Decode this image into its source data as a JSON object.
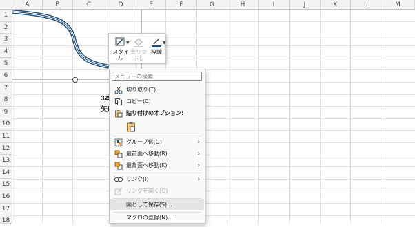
{
  "sheet": {
    "columns": [
      "A",
      "B",
      "C",
      "D",
      "E",
      "F",
      "G",
      "H",
      "I",
      "J",
      "K",
      "L",
      "M"
    ],
    "rows": [
      "1",
      "2",
      "3",
      "4",
      "5",
      "6",
      "7",
      "8",
      "9",
      "10",
      "11",
      "12",
      "13",
      "14",
      "15",
      "16",
      "17",
      "18",
      "19",
      "20"
    ],
    "cell_text_1": "3本",
    "cell_text_2": "矢印"
  },
  "mini_toolbar": {
    "style_label": "スタイル",
    "fill_label": "塗りつぶし",
    "outline_label": "枠線"
  },
  "context_menu": {
    "search_placeholder": "メニューの検索",
    "items": [
      {
        "label": "切り取り(T)",
        "icon": "scissors-icon"
      },
      {
        "label": "コピー(C)",
        "icon": "copy-icon"
      },
      {
        "label": "貼り付けのオプション:",
        "icon": "paste-options-icon"
      },
      {
        "label": "グループ化(G)",
        "icon": "group-icon",
        "submenu": true
      },
      {
        "label": "最前面へ移動(R)",
        "icon": "bring-to-front-icon",
        "submenu": true
      },
      {
        "label": "最背面へ移動(K)",
        "icon": "send-to-back-icon",
        "submenu": true
      },
      {
        "label": "リンク(I)",
        "icon": "link-icon",
        "submenu": true
      },
      {
        "label": "リンクを開く(O)",
        "icon": "open-link-icon",
        "disabled": true
      },
      {
        "label": "図として保存(S)...",
        "icon": "none"
      },
      {
        "label": "マクロの登録(N)...",
        "icon": "none"
      }
    ]
  },
  "colors": {
    "shape_outline": "#1f4e79",
    "selection": "#7f7f7f",
    "menu_hover": "#e5e5e5"
  }
}
